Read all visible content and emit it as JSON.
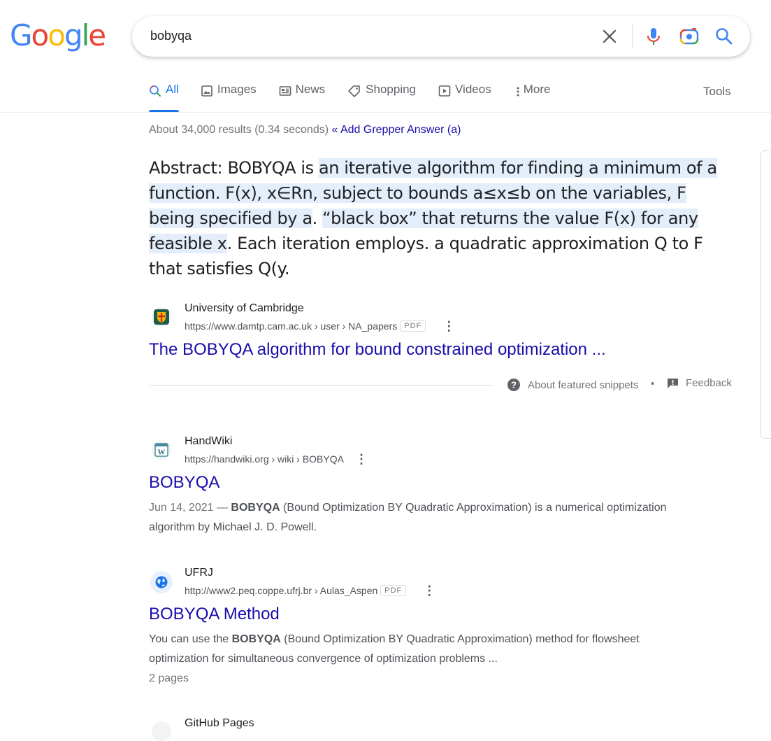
{
  "logo": {
    "letters": [
      "G",
      "o",
      "o",
      "g",
      "l",
      "e"
    ],
    "colors": [
      "#4285f4",
      "#ea4335",
      "#fbbc05",
      "#4285f4",
      "#34a853",
      "#ea4335"
    ]
  },
  "search": {
    "query": "bobyqa"
  },
  "tabs": [
    {
      "label": "All",
      "icon": "search-icon",
      "active": true
    },
    {
      "label": "Images",
      "icon": "image-icon"
    },
    {
      "label": "News",
      "icon": "news-icon"
    },
    {
      "label": "Shopping",
      "icon": "tag-icon"
    },
    {
      "label": "Videos",
      "icon": "play-icon"
    },
    {
      "label": "More",
      "icon": "dots-vertical-icon"
    }
  ],
  "tools_label": "Tools",
  "stats": {
    "text": "About 34,000 results (0.34 seconds)",
    "grepper": "« Add Grepper Answer (a)"
  },
  "snippet": {
    "pre": "Abstract: BOBYQA is ",
    "highlight1": "an iterative algorithm for finding a minimum of a function. F(x), x∈Rn, subject to bounds a≤x≤b on the variables, F being specified by a",
    "mid": ". ",
    "highlight2": "“black box” that returns the value F(x) for any feasible x",
    "post": ". Each iteration employs. a quadratic approximation Q to F that satisfies Q(y."
  },
  "featured": {
    "site_name": "University of Cambridge",
    "url": "https://www.damtp.cam.ac.uk › user › NA_papers",
    "badge": "PDF",
    "title": "The BOBYQA algorithm for bound constrained optimization ...",
    "about": "About featured snippets",
    "bullet": "•",
    "feedback": "Feedback"
  },
  "results": [
    {
      "site_name": "HandWiki",
      "url": "https://handwiki.org › wiki › BOBYQA",
      "title": "BOBYQA",
      "date": "Jun 14, 2021 — ",
      "bold": "BOBYQA",
      "desc": " (Bound Optimization BY Quadratic Approximation) is a numerical optimization algorithm by Michael J. D. Powell."
    },
    {
      "site_name": "UFRJ",
      "url": "http://www2.peq.coppe.ufrj.br › Aulas_Aspen",
      "badge": "PDF",
      "title": "BOBYQA Method",
      "pre": "You can use the ",
      "bold": "BOBYQA",
      "desc": " (Bound Optimization BY Quadratic Approximation) method for flowsheet optimization for simultaneous convergence of optimization problems ...",
      "extra": "2 pages"
    },
    {
      "site_name": "GitHub Pages"
    }
  ]
}
